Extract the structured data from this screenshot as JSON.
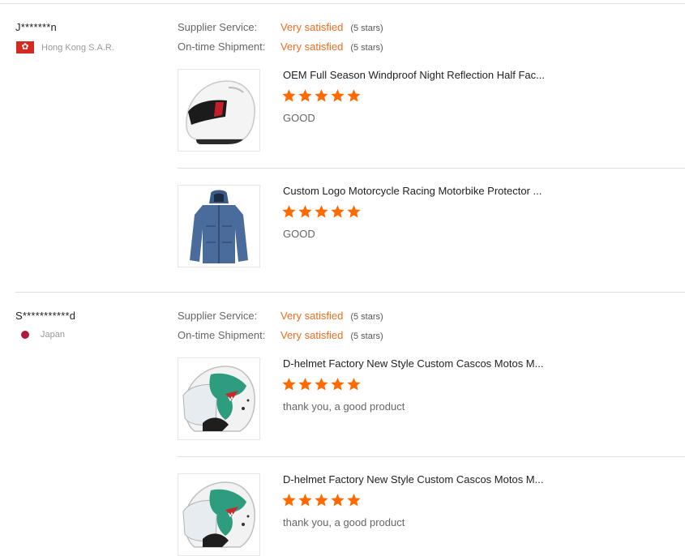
{
  "reviews": [
    {
      "buyer": "J*******n",
      "country": "Hong Kong S.A.R.",
      "flag": "hk-flag",
      "service_label": "Supplier Service:",
      "service_value": "Very satisfied",
      "service_stars": "(5 stars)",
      "shipment_label": "On-time Shipment:",
      "shipment_value": "Very satisfied",
      "shipment_stars": "(5 stars)",
      "products": [
        {
          "title": "OEM Full Season Windproof Night Reflection Half Fac...",
          "rating": 5,
          "comment": "GOOD",
          "image": "white-helmet"
        },
        {
          "title": "Custom Logo Motorcycle Racing Motorbike Protector ...",
          "rating": 5,
          "comment": "GOOD",
          "image": "blue-jacket"
        }
      ]
    },
    {
      "buyer": "S***********d",
      "country": "Japan",
      "flag": "jp-flag",
      "service_label": "Supplier Service:",
      "service_value": "Very satisfied",
      "service_stars": "(5 stars)",
      "shipment_label": "On-time Shipment:",
      "shipment_value": "Very satisfied",
      "shipment_stars": "(5 stars)",
      "products": [
        {
          "title": "D-helmet Factory New Style Custom Cascos Motos M...",
          "rating": 5,
          "comment": "thank you, a good product",
          "image": "dragon-helmet"
        },
        {
          "title": "D-helmet Factory New Style Custom Cascos Motos M...",
          "rating": 5,
          "comment": "thank you, a good product",
          "image": "dragon-helmet"
        }
      ]
    }
  ],
  "colors": {
    "accent": "#ee6c1d",
    "star": "#ff6a00",
    "divider": "#dedede"
  }
}
